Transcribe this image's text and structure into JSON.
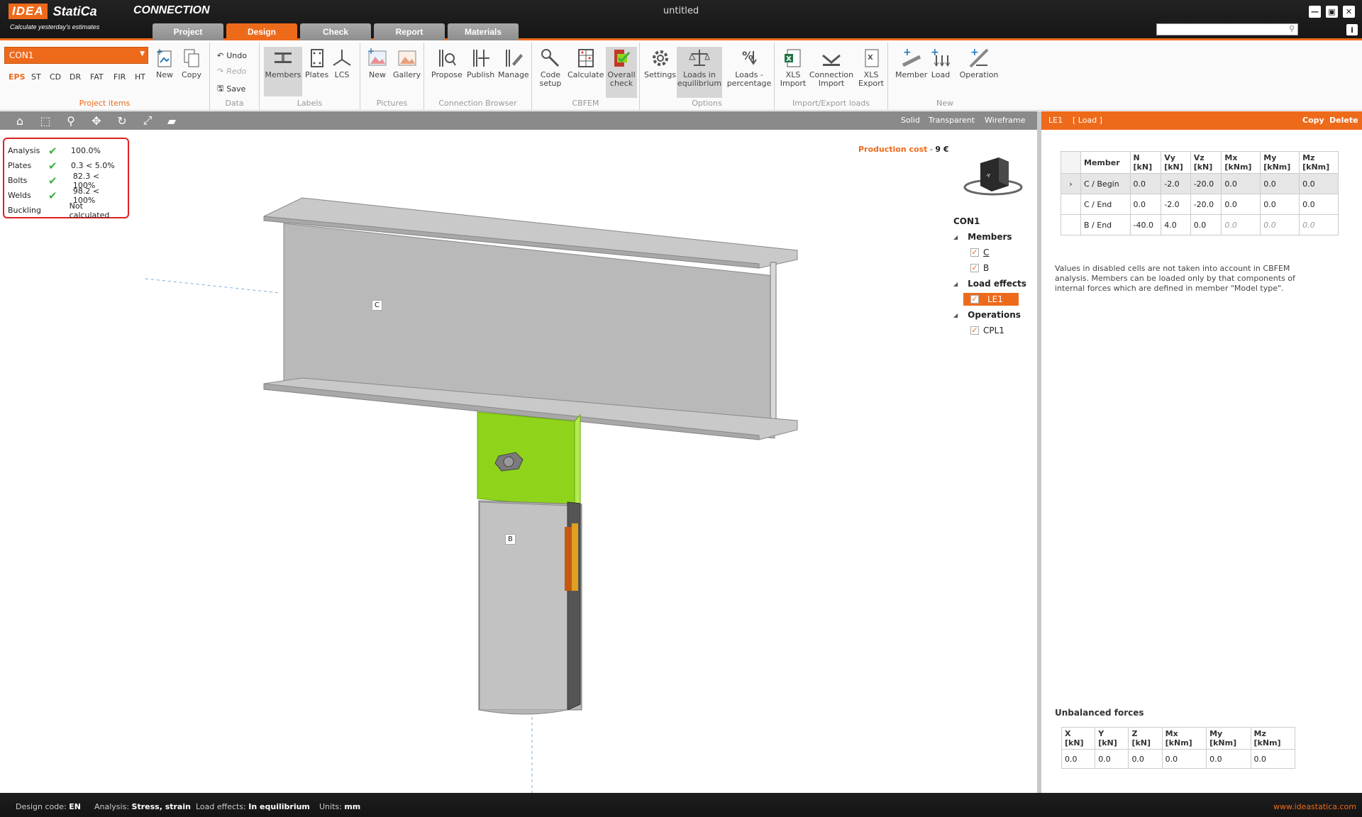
{
  "app": {
    "logo_idea": "IDEA",
    "logo_statica": "StatiCa",
    "product": "CONNECTION",
    "slogan": "Calculate yesterday's estimates",
    "window_title": "untitled"
  },
  "tabs": [
    {
      "label": "Project"
    },
    {
      "label": "Design"
    },
    {
      "label": "Check"
    },
    {
      "label": "Report"
    },
    {
      "label": "Materials"
    }
  ],
  "ribbon": {
    "project_items": {
      "selected": "CON1",
      "standards": [
        "EPS",
        "ST",
        "CD",
        "DR",
        "FAT",
        "FIR",
        "HT"
      ],
      "new": "New",
      "copy": "Copy",
      "label": "Project items"
    },
    "data": {
      "undo": "Undo",
      "redo": "Redo",
      "save": "Save",
      "label": "Data"
    },
    "labels": {
      "members": "Members",
      "plates": "Plates",
      "lcs": "LCS",
      "label": "Labels"
    },
    "pictures": {
      "new": "New",
      "gallery": "Gallery",
      "label": "Pictures"
    },
    "connection_browser": {
      "propose": "Propose",
      "publish": "Publish",
      "manage": "Manage",
      "label": "Connection Browser"
    },
    "cbfem": {
      "code_setup": "Code setup",
      "calculate": "Calculate",
      "overall_check": "Overall check",
      "label": "CBFEM"
    },
    "options": {
      "settings": "Settings",
      "loads_equilibrium": "Loads in equilibrium",
      "loads_percentage": "Loads - percentage",
      "label": "Options"
    },
    "import_export": {
      "xls_import": "XLS Import",
      "connection_import": "Connection Import",
      "xls_export": "XLS Export",
      "label": "Import/Export loads"
    },
    "new_group": {
      "member": "Member",
      "load": "Load",
      "operation": "Operation",
      "label": "New"
    }
  },
  "viewbar": {
    "solid": "Solid",
    "transparent": "Transparent",
    "wireframe": "Wireframe"
  },
  "results": [
    {
      "name": "Analysis",
      "check": "✔",
      "value": "100.0%"
    },
    {
      "name": "Plates",
      "check": "✔",
      "value": "0.3 < 5.0%"
    },
    {
      "name": "Bolts",
      "check": "✔",
      "value": "82.3 < 100%"
    },
    {
      "name": "Welds",
      "check": "✔",
      "value": "98.2 < 100%"
    },
    {
      "name": "Buckling",
      "check": "",
      "value": "Not calculated"
    }
  ],
  "production_cost": {
    "label": "Production cost",
    "sep": "-",
    "value": "9 €"
  },
  "member_labels": {
    "c": "C",
    "b": "B"
  },
  "tree": {
    "root": "CON1",
    "members_label": "Members",
    "members": [
      "C",
      "B"
    ],
    "load_effects_label": "Load effects",
    "load_effects": [
      "LE1"
    ],
    "operations_label": "Operations",
    "operations": [
      "CPL1"
    ]
  },
  "panel": {
    "title": "LE1",
    "subtitle": "[ Load ]",
    "copy": "Copy",
    "delete": "Delete",
    "headers": [
      {
        "name": "Member",
        "unit": ""
      },
      {
        "name": "N",
        "unit": "[kN]"
      },
      {
        "name": "Vy",
        "unit": "[kN]"
      },
      {
        "name": "Vz",
        "unit": "[kN]"
      },
      {
        "name": "Mx",
        "unit": "[kNm]"
      },
      {
        "name": "My",
        "unit": "[kNm]"
      },
      {
        "name": "Mz",
        "unit": "[kNm]"
      }
    ],
    "rows": [
      {
        "member": "C / Begin",
        "values": [
          "0.0",
          "-2.0",
          "-20.0",
          "0.0",
          "0.0",
          "0.0"
        ]
      },
      {
        "member": "C / End",
        "values": [
          "0.0",
          "-2.0",
          "-20.0",
          "0.0",
          "0.0",
          "0.0"
        ]
      },
      {
        "member": "B / End",
        "values": [
          "-40.0",
          "4.0",
          "0.0",
          "0.0",
          "0.0",
          "0.0"
        ]
      }
    ],
    "note": "Values in disabled cells are not taken into account in CBFEM analysis. Members can be loaded only by that components of internal forces which are defined in member \"Model type\".",
    "unbalanced_title": "Unbalanced forces",
    "unbalanced_headers": [
      {
        "name": "X",
        "unit": "[kN]"
      },
      {
        "name": "Y",
        "unit": "[kN]"
      },
      {
        "name": "Z",
        "unit": "[kN]"
      },
      {
        "name": "Mx",
        "unit": "[kNm]"
      },
      {
        "name": "My",
        "unit": "[kNm]"
      },
      {
        "name": "Mz",
        "unit": "[kNm]"
      }
    ],
    "unbalanced_values": [
      "0.0",
      "0.0",
      "0.0",
      "0.0",
      "0.0",
      "0.0"
    ]
  },
  "status": {
    "design_code_label": "Design code:",
    "design_code": "EN",
    "analysis_label": "Analysis:",
    "analysis": "Stress, strain",
    "load_effects_label": "Load effects:",
    "load_effects": "In equilibrium",
    "units_label": "Units:",
    "units": "mm",
    "website": "www.ideastatica.com"
  },
  "colors": {
    "accent": "#ee6a1b",
    "check": "#3cb043",
    "plate": "#8fd41a",
    "steel": "#b8b8b8"
  }
}
